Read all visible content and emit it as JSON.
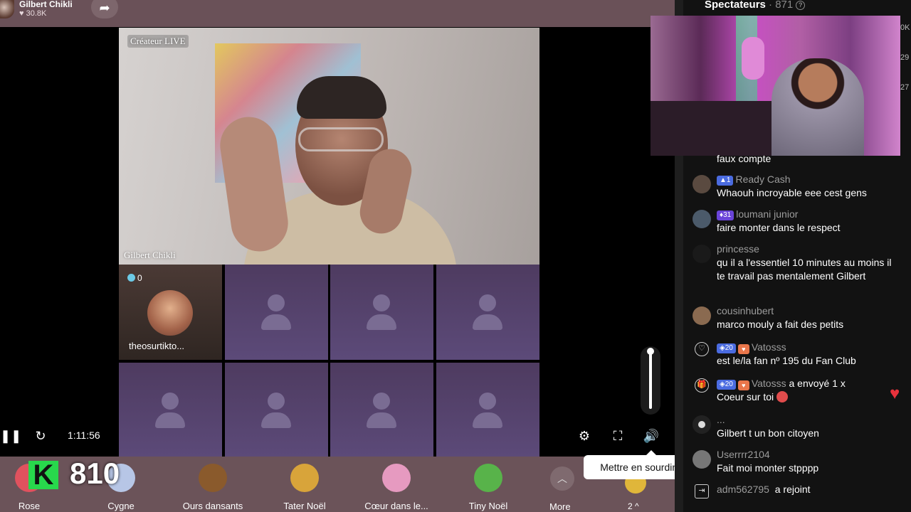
{
  "host": {
    "name": "Gilbert Chikli",
    "likes": "30.8K"
  },
  "main_cam": {
    "badge": "Créateur LIVE",
    "name": "Gilbert Chikli"
  },
  "guest": {
    "count": "0",
    "name": "theosurtikto..."
  },
  "controls": {
    "time": "1:11:56",
    "tooltip": "Mettre en sourdine (M)",
    "volume": 1.0
  },
  "gifts": [
    {
      "label": "Rose",
      "color": "#e0525e"
    },
    {
      "label": "Cygne",
      "color": "#b7c6e6"
    },
    {
      "label": "Ours dansants",
      "color": "#8a5a2c"
    },
    {
      "label": "Tater Noël",
      "color": "#d8a43a"
    },
    {
      "label": "Cœur dans le...",
      "color": "#e69ac0"
    },
    {
      "label": "Tiny Noël",
      "color": "#58b34a"
    }
  ],
  "overlay": {
    "k": "K",
    "number": "810"
  },
  "more": {
    "label": "More",
    "count": "2 ^"
  },
  "sidebar": {
    "title": "Spectateurs",
    "count": "· 871",
    "edge_labels": [
      "0K",
      "29",
      "27"
    ]
  },
  "chat": [
    {
      "user": "",
      "text": "faux compte"
    },
    {
      "user": "Ready Cash",
      "level": "1",
      "text": "Whaouh incroyable eee cest gens"
    },
    {
      "user": "loumani junior",
      "level": "31",
      "text": "faire monter dans le respect"
    },
    {
      "user": "princesse",
      "text": "qu il a l'essentiel 10 minutes au moins il te travail pas mentalement Gilbert"
    },
    {
      "user": "cousinhubert",
      "text": "marco mouly a fait des petits"
    },
    {
      "user": "Vatosss",
      "level": "20",
      "text": "est le/la fan nº 195 du Fan Club"
    },
    {
      "user": "Vatosss",
      "level": "20",
      "action": "a envoyé 1 x",
      "text": "Coeur sur toi"
    },
    {
      "user": "...",
      "text": "Gilbert t un bon citoyen"
    },
    {
      "user": "Userrrr2104",
      "text": "Fait moi monter stpppp"
    },
    {
      "user": "adm562795",
      "action": "a rejoint"
    }
  ]
}
